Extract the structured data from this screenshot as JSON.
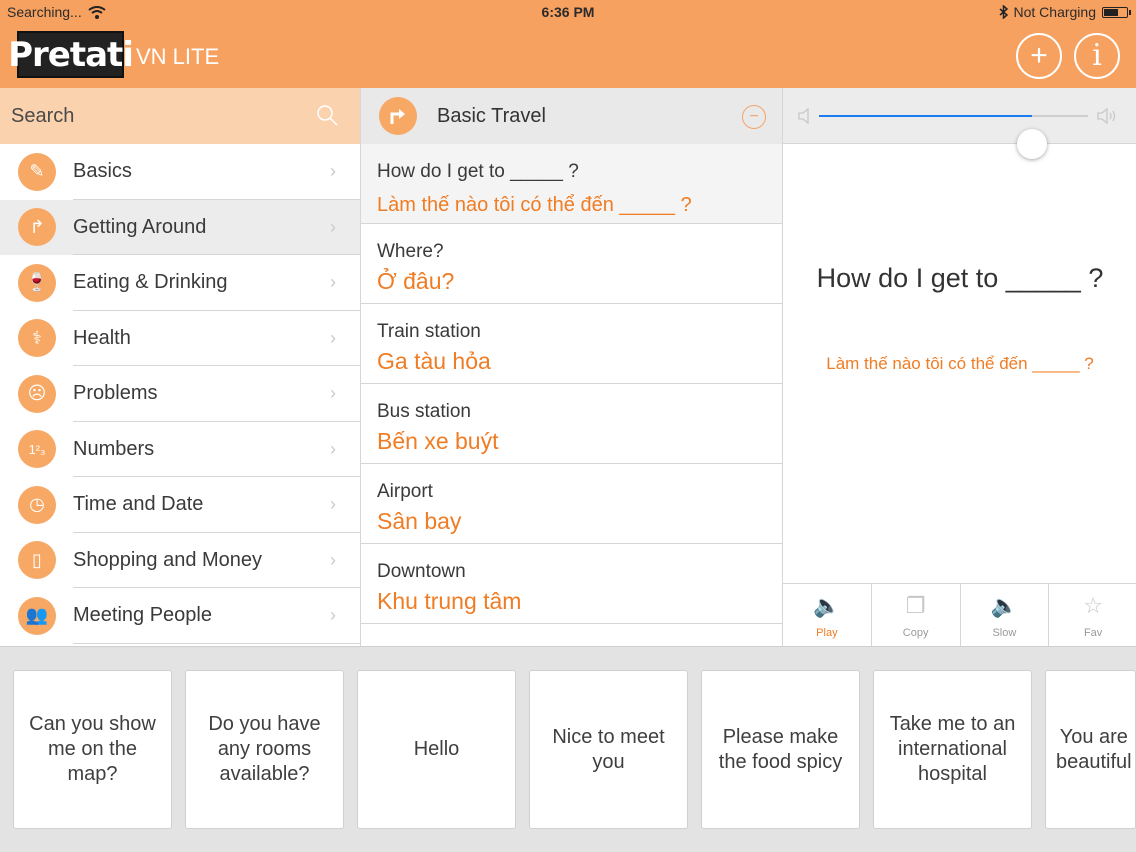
{
  "status": {
    "carrier": "Searching...",
    "time": "6:36 PM",
    "charging": "Not Charging"
  },
  "header": {
    "logo": "Pretati",
    "subtitle": "VN LITE",
    "add_icon": "plus-circle-icon",
    "info_icon": "info-circle-icon",
    "brand_color": "#f7a160"
  },
  "search": {
    "placeholder": "Search"
  },
  "categories": [
    {
      "label": "Basics",
      "icon": "pencil-icon"
    },
    {
      "label": "Getting Around",
      "icon": "turn-arrow-icon"
    },
    {
      "label": "Eating & Drinking",
      "icon": "glass-icon"
    },
    {
      "label": "Health",
      "icon": "stethoscope-icon"
    },
    {
      "label": "Problems",
      "icon": "sad-face-icon"
    },
    {
      "label": "Numbers",
      "icon": "numbers-icon"
    },
    {
      "label": "Time and Date",
      "icon": "clock-calendar-icon"
    },
    {
      "label": "Shopping and Money",
      "icon": "shopping-bag-icon"
    },
    {
      "label": "Meeting People",
      "icon": "people-icon"
    }
  ],
  "category_active_index": 1,
  "phrase_list": {
    "title": "Basic Travel",
    "items": [
      {
        "en": "How do I get to _____ ?",
        "vn": "Làm thế nào tôi có thể đến _____ ?"
      },
      {
        "en": "Where?",
        "vn": "Ở đâu?"
      },
      {
        "en": "Train station",
        "vn": "Ga tàu hỏa"
      },
      {
        "en": "Bus station",
        "vn": "Bến xe buýt"
      },
      {
        "en": "Airport",
        "vn": "Sân bay"
      },
      {
        "en": "Downtown",
        "vn": "Khu trung tâm"
      }
    ]
  },
  "detail": {
    "volume_level": 0.79,
    "english": "How do I get to _____ ?",
    "vietnamese": "Làm thế nào tôi có thể đến _____ ?",
    "actions": [
      {
        "label": "Play",
        "icon": "speaker-icon",
        "active": true
      },
      {
        "label": "Copy",
        "icon": "copy-icon",
        "active": false
      },
      {
        "label": "Slow",
        "icon": "speaker-slow-icon",
        "active": false
      },
      {
        "label": "Fav",
        "icon": "star-icon",
        "active": false
      }
    ]
  },
  "favorites": [
    "Can you show me on the map?",
    "Do you have any rooms available?",
    "Hello",
    "Nice to meet you",
    "Please make the food spicy",
    "Take me to an international hospital",
    "You are beautiful"
  ]
}
